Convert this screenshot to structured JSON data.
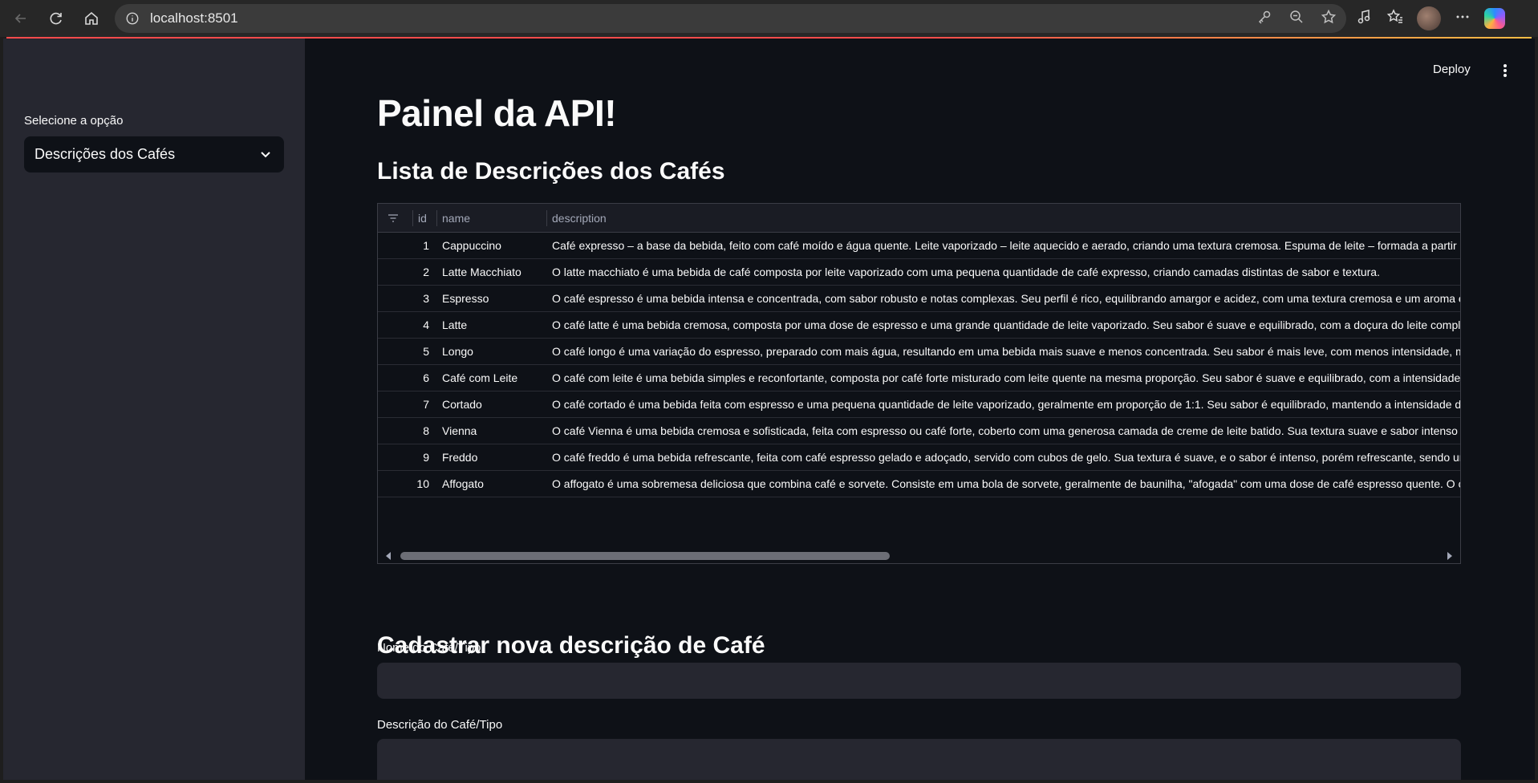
{
  "browser": {
    "url": "localhost:8501"
  },
  "app": {
    "deploy_label": "Deploy",
    "title": "Painel da API!",
    "sidebar": {
      "select_label": "Selecione a opção",
      "select_value": "Descrições dos Cafés"
    },
    "list_heading": "Lista de Descrições dos Cafés",
    "table": {
      "columns": [
        "id",
        "name",
        "description"
      ],
      "rows": [
        {
          "id": "1",
          "name": "Cappuccino",
          "description": "Café expresso – a base da bebida, feito com café moído e água quente. Leite vaporizado – leite aquecido e aerado, criando uma textura cremosa. Espuma de leite – formada a partir do leite"
        },
        {
          "id": "2",
          "name": "Latte Macchiato",
          "description": "O latte macchiato é uma bebida de café composta por leite vaporizado com uma pequena quantidade de café expresso, criando camadas distintas de sabor e textura."
        },
        {
          "id": "3",
          "name": "Espresso",
          "description": "O café espresso é uma bebida intensa e concentrada, com sabor robusto e notas complexas. Seu perfil é rico, equilibrando amargor e acidez, com uma textura cremosa e um aroma envolve"
        },
        {
          "id": "4",
          "name": "Latte",
          "description": "O café latte é uma bebida cremosa, composta por uma dose de espresso e uma grande quantidade de leite vaporizado. Seu sabor é suave e equilibrado, com a doçura do leite complement"
        },
        {
          "id": "5",
          "name": "Longo",
          "description": "O café longo é uma variação do espresso, preparado com mais água, resultando em uma bebida mais suave e menos concentrada. Seu sabor é mais leve, com menos intensidade, mas ain"
        },
        {
          "id": "6",
          "name": "Café com Leite",
          "description": "O café com leite é uma bebida simples e reconfortante, composta por café forte misturado com leite quente na mesma proporção. Seu sabor é suave e equilibrado, com a intensidade do ca"
        },
        {
          "id": "7",
          "name": "Cortado",
          "description": "O café cortado é uma bebida feita com espresso e uma pequena quantidade de leite vaporizado, geralmente em proporção de 1:1. Seu sabor é equilibrado, mantendo a intensidade do espr"
        },
        {
          "id": "8",
          "name": "Vienna",
          "description": "O café Vienna é uma bebida cremosa e sofisticada, feita com espresso ou café forte, coberto com uma generosa camada de creme de leite batido. Sua textura suave e sabor intenso são co"
        },
        {
          "id": "9",
          "name": "Freddo",
          "description": "O café freddo é uma bebida refrescante, feita com café espresso gelado e adoçado, servido com cubos de gelo. Sua textura é suave, e o sabor é intenso, porém refrescante, sendo uma op"
        },
        {
          "id": "10",
          "name": "Affogato",
          "description": "O affogato é uma sobremesa deliciosa que combina café e sorvete. Consiste em uma bola de sorvete, geralmente de baunilha, \"afogada\" com uma dose de café espresso quente. O contras"
        }
      ]
    },
    "form": {
      "heading": "Cadastrar nova descrição de Café",
      "name_label": "Nome do Café/Tipo",
      "name_value": "",
      "desc_label": "Descrição do Café/Tipo",
      "desc_value": ""
    }
  },
  "colors": {
    "app_bg": "#0e1117",
    "sidebar_bg": "#262730",
    "accent": "#ff4b4b"
  }
}
